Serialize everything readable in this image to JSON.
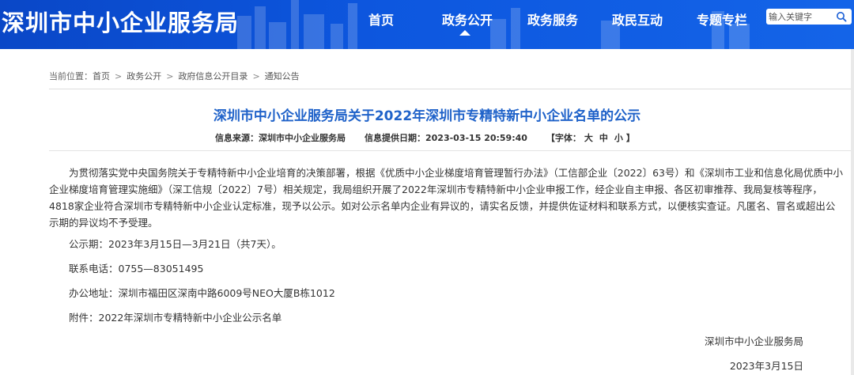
{
  "header": {
    "site_title": "深圳市中小企业服务局",
    "nav": [
      {
        "label": "首页",
        "active": false
      },
      {
        "label": "政务公开",
        "active": true
      },
      {
        "label": "政务服务",
        "active": false
      },
      {
        "label": "政民互动",
        "active": false
      },
      {
        "label": "专题专栏",
        "active": false
      }
    ],
    "search": {
      "placeholder": "输入关键字",
      "icon": "search-icon"
    },
    "colors": {
      "header_bg": "#0d57df",
      "title_color": "#1f62c9"
    }
  },
  "breadcrumb": {
    "prefix": "当前位置：",
    "separator": ">",
    "items": [
      "首页",
      "政务公开",
      "政府信息公开目录",
      "通知公告"
    ]
  },
  "article": {
    "title": "深圳市中小企业服务局关于2022年深圳市专精特新中小企业名单的公示",
    "meta": {
      "source_label": "信息来源：",
      "source_value": "深圳市中小企业服务局",
      "date_label": "信息提供日期：",
      "date_value": "2023-03-15 20:59:40",
      "font_label": "【字体：",
      "font_large": "大",
      "font_medium": "中",
      "font_small": "小",
      "font_end": "】"
    },
    "body": "为贯彻落实党中央国务院关于专精特新中小企业培育的决策部署，根据《优质中小企业梯度培育管理暂行办法》（工信部企业〔2022〕63号）和《深圳市工业和信息化局优质中小企业梯度培育管理实施细》（深工信规〔2022〕7号）相关规定，我局组织开展了2022年深圳市专精特新中小企业申报工作，经企业自主申报、各区初审推荐、我局复核等程序，4818家企业符合深圳市专精特新中小企业认定标准，现予以公示。如对公示名单内企业有异议的，请实名反馈，并提供佐证材料和联系方式，以便核实查证。凡匿名、冒名或超出公示期的异议均不予受理。",
    "lines": {
      "period": "公示期：2023年3月15日—3月21日（共7天）。",
      "phone": "联系电话：0755—83051495",
      "address": "办公地址：深圳市福田区深南中路6009号NEO大厦B栋1012",
      "attachment": "附件：2022年深圳市专精特新中小企业公示名单"
    },
    "signature": "深圳市中小企业服务局",
    "sign_date": "2023年3月15日"
  }
}
